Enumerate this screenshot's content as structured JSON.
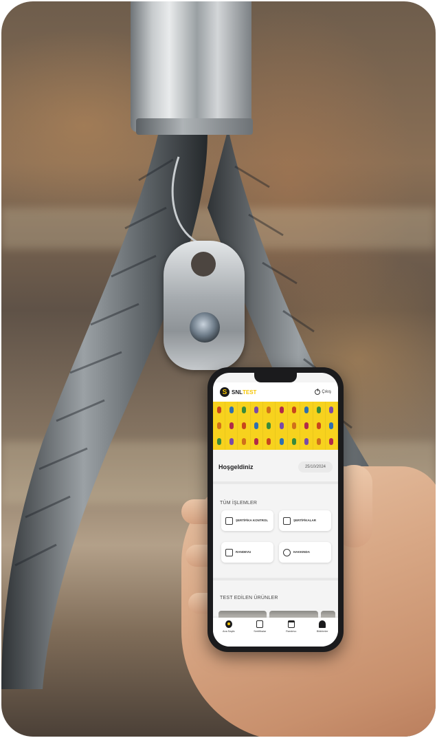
{
  "app": {
    "brand_prefix": "SNL",
    "brand_suffix": "TEST",
    "exit_label": "Çıkış"
  },
  "welcome": {
    "title": "Hoşgeldiniz",
    "date": "25/10/2024"
  },
  "operations": {
    "section_title": "TÜM İŞLEMLER",
    "items": [
      {
        "label": "ŞERTİFİKA KONTROL",
        "icon": "qr-scan-icon"
      },
      {
        "label": "ŞERTİFİKALAR",
        "icon": "certificate-icon"
      },
      {
        "label": "RANDEVU",
        "icon": "calendar-icon"
      },
      {
        "label": "HAKKINDA",
        "icon": "info-person-icon"
      }
    ]
  },
  "products": {
    "section_title": "TEST EDİLEN ÜRÜNLER"
  },
  "tabbar": {
    "items": [
      {
        "label": "Ana Sayfa",
        "icon": "home-logo-icon"
      },
      {
        "label": "Sertifikalar",
        "icon": "document-icon"
      },
      {
        "label": "Randevu",
        "icon": "calendar-add-icon"
      },
      {
        "label": "Bildirimler",
        "icon": "bell-icon"
      }
    ]
  },
  "colors": {
    "accent": "#f5c400",
    "banner": "#f7d21e",
    "dark": "#1b1b1d"
  }
}
